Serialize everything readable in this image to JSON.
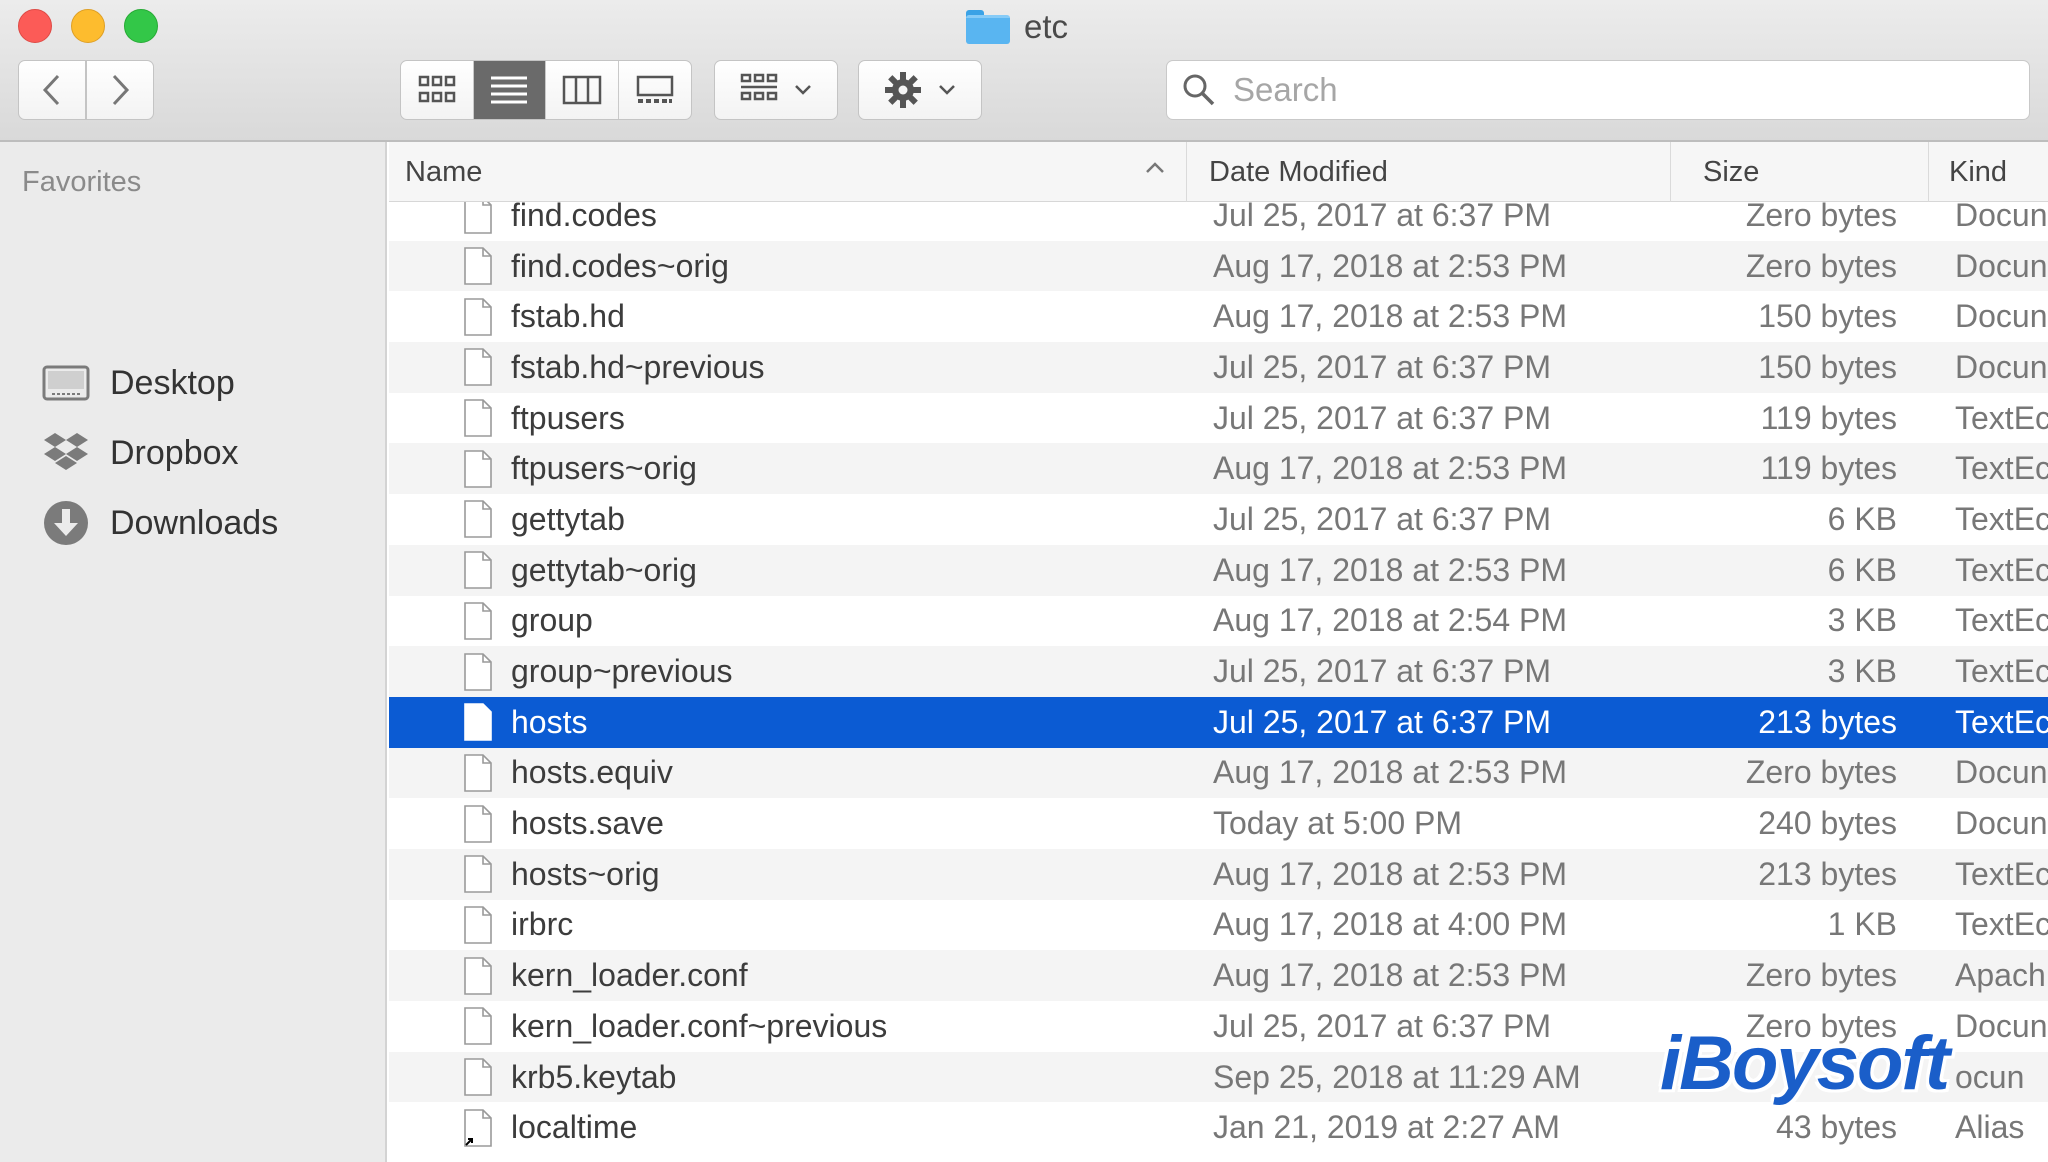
{
  "window": {
    "title": "etc",
    "folder_icon": "folder-icon",
    "traffic_lights": {
      "close": "#fc5b57",
      "minimize": "#fdbc2e",
      "zoom": "#33c748"
    }
  },
  "toolbar": {
    "back_icon": "chevron-left-icon",
    "forward_icon": "chevron-right-icon",
    "views": [
      {
        "icon": "icon-view-icon",
        "active": false
      },
      {
        "icon": "list-view-icon",
        "active": true
      },
      {
        "icon": "column-view-icon",
        "active": false
      },
      {
        "icon": "gallery-view-icon",
        "active": false
      }
    ],
    "group_icon": "group-by-icon",
    "action_icon": "gear-icon",
    "search_placeholder": "Search"
  },
  "sidebar": {
    "heading": "Favorites",
    "items": [
      {
        "label": "Desktop",
        "icon": "desktop-icon"
      },
      {
        "label": "Dropbox",
        "icon": "dropbox-icon"
      },
      {
        "label": "Downloads",
        "icon": "downloads-icon"
      }
    ]
  },
  "columns": {
    "name": "Name",
    "date": "Date Modified",
    "size": "Size",
    "kind": "Kind"
  },
  "files": [
    {
      "name": "find.codes",
      "date": "Jul 25, 2017 at 6:37 PM",
      "size": "Zero bytes",
      "kind": "Docun"
    },
    {
      "name": "find.codes~orig",
      "date": "Aug 17, 2018 at 2:53 PM",
      "size": "Zero bytes",
      "kind": "Docun"
    },
    {
      "name": "fstab.hd",
      "date": "Aug 17, 2018 at 2:53 PM",
      "size": "150 bytes",
      "kind": "Docun"
    },
    {
      "name": "fstab.hd~previous",
      "date": "Jul 25, 2017 at 6:37 PM",
      "size": "150 bytes",
      "kind": "Docun"
    },
    {
      "name": "ftpusers",
      "date": "Jul 25, 2017 at 6:37 PM",
      "size": "119 bytes",
      "kind": "TextEc"
    },
    {
      "name": "ftpusers~orig",
      "date": "Aug 17, 2018 at 2:53 PM",
      "size": "119 bytes",
      "kind": "TextEc"
    },
    {
      "name": "gettytab",
      "date": "Jul 25, 2017 at 6:37 PM",
      "size": "6 KB",
      "kind": "TextEc"
    },
    {
      "name": "gettytab~orig",
      "date": "Aug 17, 2018 at 2:53 PM",
      "size": "6 KB",
      "kind": "TextEc"
    },
    {
      "name": "group",
      "date": "Aug 17, 2018 at 2:54 PM",
      "size": "3 KB",
      "kind": "TextEc"
    },
    {
      "name": "group~previous",
      "date": "Jul 25, 2017 at 6:37 PM",
      "size": "3 KB",
      "kind": "TextEc"
    },
    {
      "name": "hosts",
      "date": "Jul 25, 2017 at 6:37 PM",
      "size": "213 bytes",
      "kind": "TextEc",
      "selected": true
    },
    {
      "name": "hosts.equiv",
      "date": "Aug 17, 2018 at 2:53 PM",
      "size": "Zero bytes",
      "kind": "Docun"
    },
    {
      "name": "hosts.save",
      "date": "Today at 5:00 PM",
      "size": "240 bytes",
      "kind": "Docun"
    },
    {
      "name": "hosts~orig",
      "date": "Aug 17, 2018 at 2:53 PM",
      "size": "213 bytes",
      "kind": "TextEc"
    },
    {
      "name": "irbrc",
      "date": "Aug 17, 2018 at 4:00 PM",
      "size": "1 KB",
      "kind": "TextEc"
    },
    {
      "name": "kern_loader.conf",
      "date": "Aug 17, 2018 at 2:53 PM",
      "size": "Zero bytes",
      "kind": "Apach"
    },
    {
      "name": "kern_loader.conf~previous",
      "date": "Jul 25, 2017 at 6:37 PM",
      "size": "Zero bytes",
      "kind": "Docun"
    },
    {
      "name": "krb5.keytab",
      "date": "Sep 25, 2018 at 11:29 AM",
      "size": "",
      "kind": "ocun"
    },
    {
      "name": "localtime",
      "date": "Jan 21, 2019 at 2:27 AM",
      "size": "43 bytes",
      "kind": "Alias",
      "alias": true
    }
  ],
  "watermark": "iBoysoft",
  "colors": {
    "selection": "#0b5bd3",
    "stripe": "#f4f4f4",
    "sidebar": "#ebebeb",
    "watermark": "#1a5ec9"
  }
}
